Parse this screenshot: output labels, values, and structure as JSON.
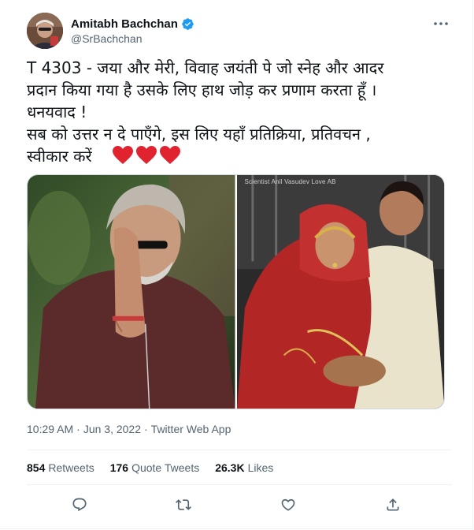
{
  "tweet": {
    "author": {
      "display_name": "Amitabh Bachchan",
      "handle": "@SrBachchan",
      "verified": true
    },
    "text": "T 4303 - जया और मेरी, विवाह जयंती पे जो स्नेह और आदर\nप्रदान किया गया है उसके लिए हाथ जोड़ कर प्रणाम करता हूँ  ।\nधनयवाद  !\nसब को उत्तर न दे पाएँगे, इस लिए यहाँ प्रतिक्रिया, प्रतिवचन ,\nस्वीकार करें",
    "emoji": [
      "red-heart",
      "red-heart",
      "red-heart"
    ],
    "media": [
      {
        "name": "photo-folded-hands",
        "watermark": ""
      },
      {
        "name": "photo-wedding",
        "watermark": "Scientist Anil Vasudev Love AB"
      }
    ],
    "time": "10:29 AM",
    "separator": "·",
    "date": "Jun 3, 2022",
    "source": "Twitter Web App",
    "stats": {
      "retweets_count": "854",
      "retweets_label": "Retweets",
      "quotes_count": "176",
      "quotes_label": "Quote Tweets",
      "likes_count": "26.3K",
      "likes_label": "Likes"
    }
  },
  "actions": [
    "reply-icon",
    "retweet-icon",
    "like-icon",
    "share-icon"
  ],
  "colors": {
    "text_primary": "#0f1419",
    "text_secondary": "#536471",
    "verified_blue": "#1d9bf0",
    "heart_red": "#e0232e",
    "divider": "#eff3f4"
  }
}
